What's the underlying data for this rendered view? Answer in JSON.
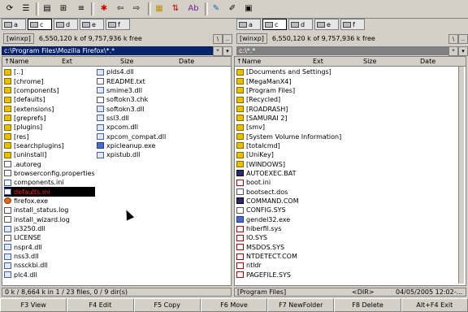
{
  "toolbar": {
    "icons": [
      "refresh-icon",
      "brief-view-icon",
      "full-view-icon",
      "tree-view-icon",
      "sort-name-icon",
      "sort-ext-icon",
      "invert-selection-icon",
      "back-icon",
      "forward-icon",
      "pack-files-icon",
      "ftp-connect-icon",
      "multi-rename-icon",
      "notepad-icon",
      "edit-icon",
      "dos-icon"
    ]
  },
  "left": {
    "drives": [
      "a",
      "c",
      "d",
      "e",
      "f"
    ],
    "selected_drive": "c",
    "volume": "[winxp]",
    "free": "6,550,120 k of 9,757,936 k free",
    "path": "c:\\Program Files\\Mozilla Firefox\\*.*",
    "columns": {
      "name": "↑Name",
      "ext": "Ext",
      "size": "Size",
      "date": "Date"
    },
    "col1": [
      {
        "name": "[..]",
        "type": "up"
      },
      {
        "name": "[chrome]",
        "type": "folder"
      },
      {
        "name": "[components]",
        "type": "folder"
      },
      {
        "name": "[defaults]",
        "type": "folder"
      },
      {
        "name": "[extensions]",
        "type": "folder"
      },
      {
        "name": "[greprefs]",
        "type": "folder"
      },
      {
        "name": "[plugins]",
        "type": "folder"
      },
      {
        "name": "[res]",
        "type": "folder"
      },
      {
        "name": "[searchplugins]",
        "type": "folder"
      },
      {
        "name": "[uninstall]",
        "type": "folder"
      },
      {
        "name": ".autoreg",
        "type": "file"
      },
      {
        "name": "browserconfig.properties",
        "type": "file"
      },
      {
        "name": "components.ini",
        "type": "link"
      },
      {
        "name": "defaults.ini",
        "type": "link",
        "highlight": true
      },
      {
        "name": "firefox.exe",
        "type": "fx"
      },
      {
        "name": "install_status.log",
        "type": "file"
      },
      {
        "name": "install_wizard.log",
        "type": "file"
      },
      {
        "name": "js3250.dll",
        "type": "dll"
      },
      {
        "name": "LICENSE",
        "type": "file"
      },
      {
        "name": "nspr4.dll",
        "type": "dll"
      },
      {
        "name": "nss3.dll",
        "type": "dll"
      },
      {
        "name": "nssckbi.dll",
        "type": "dll"
      },
      {
        "name": "plc4.dll",
        "type": "dll"
      }
    ],
    "col2": [
      {
        "name": "plds4.dll",
        "type": "dll"
      },
      {
        "name": "README.txt",
        "type": "file"
      },
      {
        "name": "smime3.dll",
        "type": "dll"
      },
      {
        "name": "softokn3.chk",
        "type": "file"
      },
      {
        "name": "softokn3.dll",
        "type": "dll"
      },
      {
        "name": "ssl3.dll",
        "type": "dll"
      },
      {
        "name": "xpcom.dll",
        "type": "dll"
      },
      {
        "name": "xpcom_compat.dll",
        "type": "dll"
      },
      {
        "name": "xpicleanup.exe",
        "type": "exe"
      },
      {
        "name": "xpistub.dll",
        "type": "dll"
      }
    ],
    "status": "0 k / 8,664 k in 1 / 23 files, 0 / 9 dir(s)"
  },
  "right": {
    "drives": [
      "a",
      "c",
      "d",
      "e",
      "f"
    ],
    "selected_drive": "c",
    "volume": "[winxp]",
    "free": "6,550,120 k of 9,757,936 k free",
    "path": "c:\\*.*",
    "columns": {
      "name": "↑Name",
      "ext": "Ext",
      "size": "Size",
      "date": "Date"
    },
    "items": [
      {
        "name": "[Documents and Settings]",
        "type": "folder"
      },
      {
        "name": "[MegaManX4]",
        "type": "folder"
      },
      {
        "name": "[Program Files]",
        "type": "folder"
      },
      {
        "name": "[Recycled]",
        "type": "folder"
      },
      {
        "name": "[ROADRASH]",
        "type": "folder"
      },
      {
        "name": "[SAMURAI 2]",
        "type": "folder"
      },
      {
        "name": "[smv]",
        "type": "folder"
      },
      {
        "name": "[System Volume Information]",
        "type": "folder"
      },
      {
        "name": "[totalcmd]",
        "type": "folder"
      },
      {
        "name": "[UniKey]",
        "type": "folder"
      },
      {
        "name": "[WINDOWS]",
        "type": "folder"
      },
      {
        "name": "AUTOEXEC.BAT",
        "type": "bat"
      },
      {
        "name": "boot.ini",
        "type": "sys"
      },
      {
        "name": "bootsect.dos",
        "type": "file"
      },
      {
        "name": "COMMAND.COM",
        "type": "bat"
      },
      {
        "name": "CONFIG.SYS",
        "type": "file"
      },
      {
        "name": "gendel32.exe",
        "type": "exe"
      },
      {
        "name": "hiberfil.sys",
        "type": "sys"
      },
      {
        "name": "IO.SYS",
        "type": "sys"
      },
      {
        "name": "MSDOS.SYS",
        "type": "sys"
      },
      {
        "name": "NTDETECT.COM",
        "type": "sys"
      },
      {
        "name": "ntldr",
        "type": "sys"
      },
      {
        "name": "PAGEFILE.SYS",
        "type": "sys"
      }
    ],
    "status_name": "[Program Files]",
    "status_type": "<DIR>",
    "status_date": "04/05/2005 12:02-..."
  },
  "fkeys": [
    "F3 View",
    "F4 Edit",
    "F5 Copy",
    "F6 Move",
    "F7 NewFolder",
    "F8 Delete",
    "Alt+F4 Exit"
  ],
  "colors": {
    "active_path": "#0a246a",
    "inactive_path": "#808080",
    "highlight_text": "#ff2020"
  }
}
